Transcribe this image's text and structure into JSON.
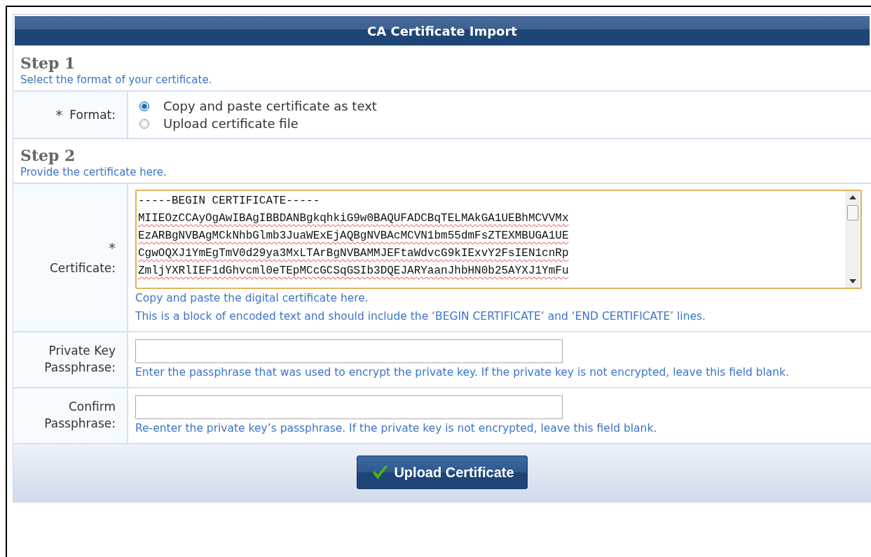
{
  "panel": {
    "title": "CA Certificate Import"
  },
  "step1": {
    "heading": "Step 1",
    "description": "Select the format of your certificate."
  },
  "format": {
    "required_mark": "*",
    "label": "Format:",
    "options": [
      {
        "label": "Copy and paste certificate as text",
        "selected": true
      },
      {
        "label": "Upload certificate file",
        "selected": false
      }
    ]
  },
  "step2": {
    "heading": "Step 2",
    "description": "Provide the certificate here."
  },
  "certificate": {
    "required_mark": "*",
    "label": "Certificate:",
    "value_lines": [
      "-----BEGIN CERTIFICATE-----",
      "MIIEOzCCAyOgAwIBAgIBBDANBgkqhkiG9w0BAQUFADCBqTELMAkGA1UEBhMCVVMx",
      "EzARBgNVBAgMCkNhbGlmb3JuaWExEjAQBgNVBAcMCVN1bm55dmFsZTEXMBUGA1UE",
      "CgwOQXJ1YmEgTmV0d29ya3MxLTArBgNVBAMMJEFtaWdvcG9kIExvY2FsIEN1cnRp",
      "ZmljYXRlIEF1dGhvcml0eTEpMCcGCSqGSIb3DQEJARYaanJhbHN0b25AYXJ1YmFu"
    ],
    "hints": [
      "Copy and paste the digital certificate here.",
      "This is a block of encoded text and should include the ‘BEGIN CERTIFICATE’ and ‘END CERTIFICATE’ lines."
    ]
  },
  "private_key": {
    "label": "Private Key Passphrase:",
    "hint": "Enter the passphrase that was used to encrypt the private key. If the private key is not encrypted, leave this field blank."
  },
  "confirm": {
    "label": "Confirm Passphrase:",
    "hint": "Re-enter the private key’s passphrase. If the private key is not encrypted, leave this field blank."
  },
  "submit": {
    "label": "Upload Certificate"
  }
}
